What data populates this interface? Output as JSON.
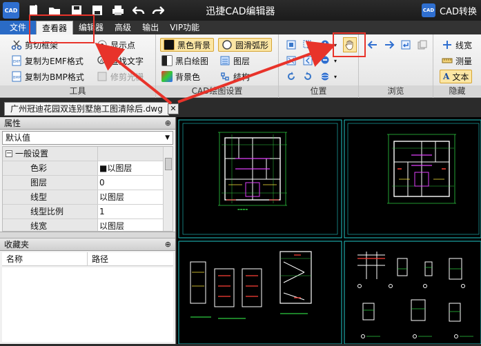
{
  "titlebar": {
    "app_title": "迅捷CAD编辑器",
    "logo_text": "CAD",
    "convert_label": "CAD转换",
    "convert_badge": "CAD"
  },
  "menubar": {
    "items": [
      "文件",
      "查看器",
      "编辑器",
      "高级",
      "输出",
      "VIP功能"
    ],
    "active": "查看器"
  },
  "ribbon": {
    "tools": {
      "label": "工具",
      "buttons": [
        "剪切框架",
        "复制为EMF格式",
        "复制为BMP格式",
        "显示点",
        "查找文字",
        "修剪光栅"
      ]
    },
    "drawing_settings": {
      "label": "CAD绘图设置",
      "buttons": [
        "黑色背景",
        "黑白绘图",
        "背景色",
        "圆滑弧形",
        "图层",
        "结构"
      ]
    },
    "position": {
      "label": "位置"
    },
    "browse": {
      "label": "浏览"
    },
    "hide": {
      "label": "隐藏",
      "buttons": [
        "线宽",
        "测量",
        "文本"
      ]
    }
  },
  "document": {
    "tab_name": "广州冠迪花园双连别墅施工图清除后.dwg",
    "close_glyph": "✕"
  },
  "properties": {
    "header": "属性",
    "pin": "⊕",
    "default_value": "默认值",
    "group_name": "一般设置",
    "rows": [
      {
        "key": "色彩",
        "value": "■以图层"
      },
      {
        "key": "图层",
        "value": "0"
      },
      {
        "key": "线型",
        "value": "以图层"
      },
      {
        "key": "线型比例",
        "value": "1"
      },
      {
        "key": "线宽",
        "value": "以图层"
      }
    ]
  },
  "favorites": {
    "header": "收藏夹",
    "pin": "⊕",
    "columns": [
      "名称",
      "路径"
    ]
  },
  "colors": {
    "sheet_border": "#22c7c7",
    "highlight": "#e8332a",
    "file_menu": "#2a6bc6"
  }
}
